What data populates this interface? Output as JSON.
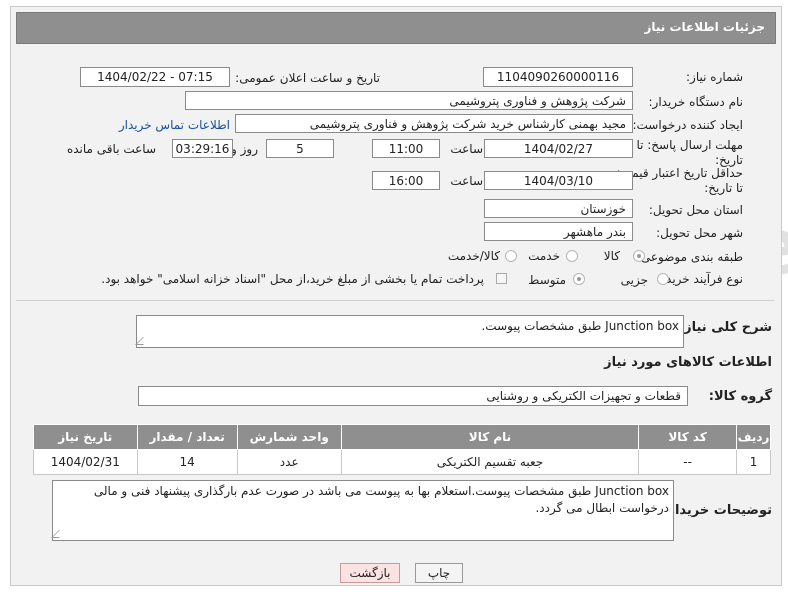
{
  "header": {
    "title": "جزئیات اطلاعات نیاز"
  },
  "fields": {
    "need_number_label": "شماره نیاز:",
    "need_number": "1104090260000116",
    "announce_label": "تاریخ و ساعت اعلان عمومی:",
    "announce_value": "1404/02/22 - 07:15",
    "buyer_label": "نام دستگاه خریدار:",
    "buyer_value": "شرکت پژوهش و فناوری پتروشیمی",
    "creator_label": "ایجاد کننده درخواست:",
    "creator_value": "مجید بهمنی کارشناس خرید شرکت پژوهش و فناوری پتروشیمی",
    "contact_link": "اطلاعات تماس خریدار",
    "deadline_label": "مهلت ارسال پاسخ: تا تاریخ:",
    "deadline_date": "1404/02/27",
    "time_label": "ساعت",
    "deadline_time": "11:00",
    "days_value": "5",
    "days_label": "روز و",
    "remaining_time": "03:29:16",
    "remaining_label": "ساعت باقی مانده",
    "validity_label": "حداقل تاریخ اعتبار قیمت: تا تاریخ:",
    "validity_date": "1404/03/10",
    "validity_time": "16:00",
    "province_label": "استان محل تحویل:",
    "province_value": "خوزستان",
    "city_label": "شهر محل تحویل:",
    "city_value": "بندر ماهشهر",
    "category_label": "طبقه بندی موضوعی:",
    "category_options": [
      "کالا",
      "خدمت",
      "کالا/خدمت"
    ],
    "process_label": "نوع فرآیند خرید :",
    "process_options": [
      "جزیی",
      "متوسط"
    ],
    "payment_note": "پرداخت تمام یا بخشی از مبلغ خرید،از محل \"اسناد خزانه اسلامی\" خواهد بود.",
    "description_label": "شرح کلی نیاز:",
    "description_value": "Junction box طبق مشخصات پیوست."
  },
  "goods": {
    "section_title": "اطلاعات کالاهای مورد نیاز",
    "group_label": "گروه کالا:",
    "group_value": "قطعات و تجهیزات الکتریکی و روشنایی",
    "columns": [
      "ردیف",
      "کد کالا",
      "نام کالا",
      "واحد شمارش",
      "تعداد / مقدار",
      "تاریخ نیاز"
    ],
    "rows": [
      [
        "1",
        "--",
        "جعبه تقسیم الکتریکی",
        "عدد",
        "14",
        "1404/02/31"
      ]
    ]
  },
  "notes": {
    "label": "توضیحات خریدار:",
    "value": "Junction box طبق مشخصات پیوست.استعلام بها به پیوست می باشد در صورت عدم بارگذاری پیشنهاد فنی و مالی درخواست ابطال می گردد."
  },
  "buttons": {
    "print": "چاپ",
    "back": "بازگشت"
  },
  "watermark": "AriaTender.net"
}
